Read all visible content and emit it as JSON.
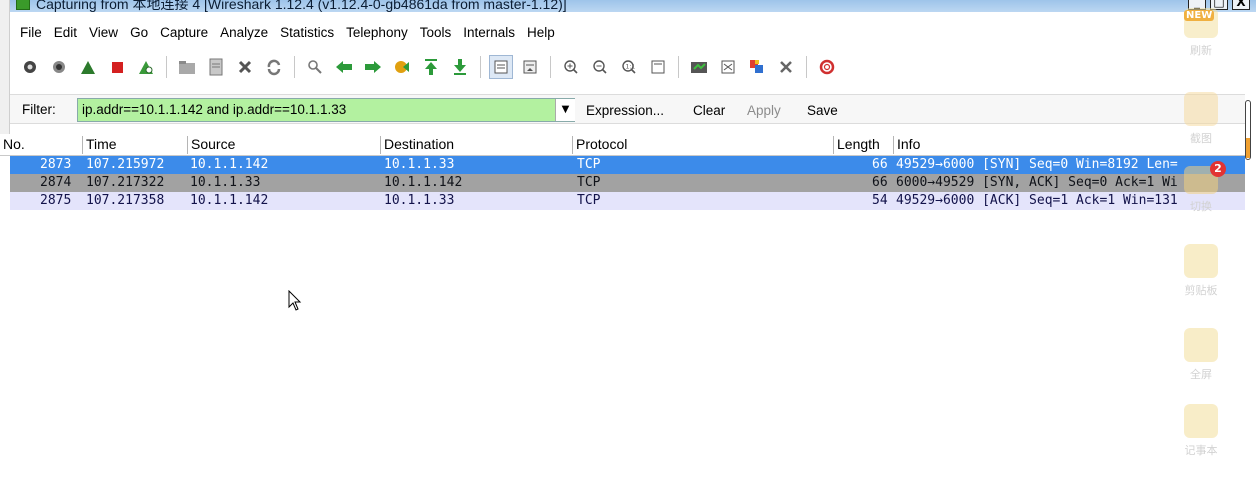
{
  "window": {
    "title": "Capturing from 本地连接 4   [Wireshark 1.12.4  (v1.12.4-0-gb4861da from master-1.12)]",
    "buttons": [
      "_",
      "□",
      "X"
    ]
  },
  "menu": [
    {
      "label": "File"
    },
    {
      "label": "Edit"
    },
    {
      "label": "View"
    },
    {
      "label": "Go"
    },
    {
      "label": "Capture"
    },
    {
      "label": "Analyze"
    },
    {
      "label": "Statistics"
    },
    {
      "label": "Telephony"
    },
    {
      "label": "Tools"
    },
    {
      "label": "Internals"
    },
    {
      "label": "Help"
    }
  ],
  "toolbar": {
    "icons": [
      "interfaces-icon",
      "options-icon",
      "start-icon",
      "stop-icon",
      "restart-icon",
      "open-icon",
      "save-icon",
      "close-icon",
      "reload-icon",
      "find-icon",
      "back-icon",
      "forward-icon",
      "goto-icon",
      "first-icon",
      "last-icon",
      "colorize-icon",
      "autoscroll-icon",
      "zoom-in-icon",
      "zoom-out-icon",
      "normal-size-icon",
      "resize-columns-icon",
      "capture-filters-icon",
      "display-filters-icon",
      "coloring-rules-icon",
      "preferences-icon",
      "help-icon"
    ],
    "colors": {
      "start": "#2c7a2c",
      "stop": "#d42020",
      "arrows": "#2c9a3a",
      "goto": "#e0a010"
    }
  },
  "filter": {
    "label": "Filter:",
    "value": "ip.addr==10.1.1.142 and ip.addr==10.1.1.33",
    "expression": "Expression...",
    "clear": "Clear",
    "apply": "Apply",
    "save": "Save",
    "color": "#b3f1a0"
  },
  "columns": {
    "no": "No.",
    "time": "Time",
    "source": "Source",
    "destination": "Destination",
    "protocol": "Protocol",
    "length": "Length",
    "info": "Info"
  },
  "packets": [
    {
      "no": "2873",
      "time": "107.215972",
      "source": "10.1.1.142",
      "destination": "10.1.1.33",
      "protocol": "TCP",
      "length": "66",
      "info": "49529→6000 [SYN] Seq=0 Win=8192 Len="
    },
    {
      "no": "2874",
      "time": "107.217322",
      "source": "10.1.1.33",
      "destination": "10.1.1.142",
      "protocol": "TCP",
      "length": "66",
      "info": "6000→49529 [SYN, ACK] Seq=0 Ack=1 Wi"
    },
    {
      "no": "2875",
      "time": "107.217358",
      "source": "10.1.1.142",
      "destination": "10.1.1.33",
      "protocol": "TCP",
      "length": "54",
      "info": "49529→6000 [ACK] Seq=1 Ack=1 Win=131"
    }
  ],
  "row_colors": {
    "selected": "#3c8bea",
    "gray": "#a2a2a2",
    "lavender": "#e4e4fb"
  },
  "dock": {
    "new_badge": "NEW",
    "items": [
      {
        "label": "刷新"
      },
      {
        "label": "截图"
      },
      {
        "label": "切换"
      },
      {
        "label": "剪贴板"
      },
      {
        "label": "全屏"
      },
      {
        "label": "记事本"
      }
    ],
    "badge_count": "2"
  }
}
